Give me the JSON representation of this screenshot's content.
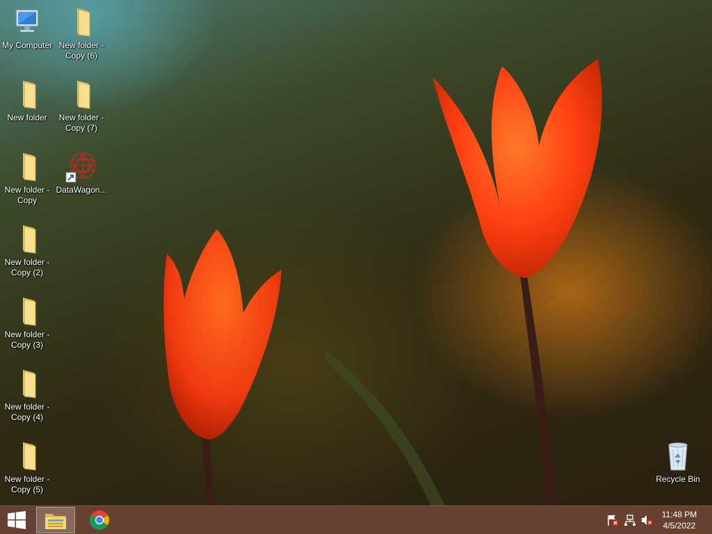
{
  "desktop_icons": [
    {
      "label": "My Computer",
      "type": "computer"
    },
    {
      "label": "New folder - Copy (6)",
      "type": "folder"
    },
    {
      "label": "New folder",
      "type": "folder"
    },
    {
      "label": "New folder - Copy (7)",
      "type": "folder"
    },
    {
      "label": "New folder - Copy",
      "type": "folder"
    },
    {
      "label": "DataWagon...",
      "type": "shortcut"
    },
    {
      "label": "New folder - Copy (2)",
      "type": "folder"
    },
    {
      "label": "New folder - Copy (3)",
      "type": "folder"
    },
    {
      "label": "New folder - Copy (4)",
      "type": "folder"
    },
    {
      "label": "New folder - Copy (5)",
      "type": "folder"
    },
    {
      "label": "Recycle Bin",
      "type": "recycle-bin"
    }
  ],
  "taskbar": {
    "start_icon": "windows-logo-icon",
    "pinned": [
      {
        "name": "file-explorer",
        "icon": "folder-icon",
        "active": true
      },
      {
        "name": "google-chrome",
        "icon": "chrome-icon",
        "active": false
      }
    ],
    "tray_icons": [
      "action-center-flag-icon",
      "network-icon",
      "volume-muted-icon"
    ],
    "clock": {
      "time": "11:48 PM",
      "date": "4/5/2022"
    }
  },
  "colors": {
    "taskbar": "#6e4637",
    "tulip": "#ff4a1a",
    "folder": "#f3d77a"
  }
}
